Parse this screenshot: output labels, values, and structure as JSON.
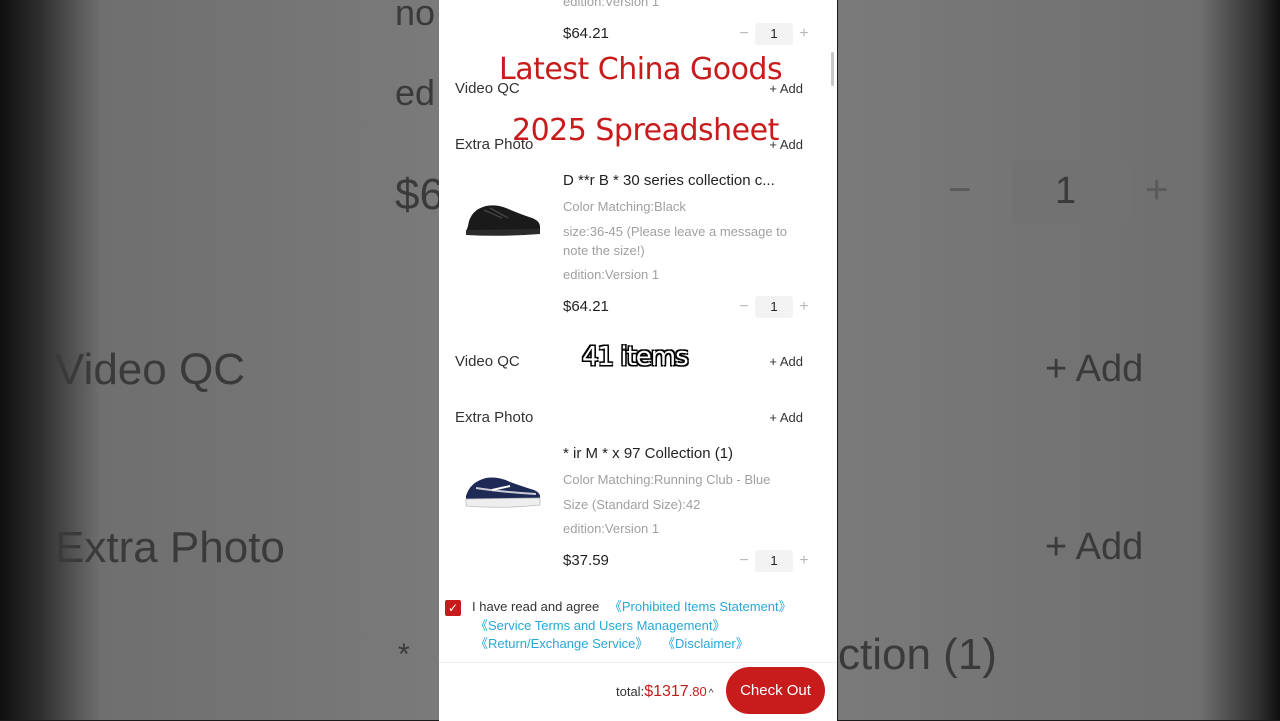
{
  "overlay": {
    "line1": "Latest China Goods",
    "line2": "2025 Spreadsheet",
    "items_count": "41 items"
  },
  "background_text": {
    "no": "no",
    "ed": "ed",
    "price": "$6",
    "qty_minus": "−",
    "qty_value": "1",
    "qty_plus": "+",
    "video_qc": "Video QC",
    "add1": "+ Add",
    "extra_photo": "Extra Photo",
    "add2": "+ Add",
    "star": "*",
    "collection": "ction (1)"
  },
  "cart": {
    "top_partial_spec": "edition:Version 1",
    "items": [
      {
        "price": "$64.21",
        "qty": "1"
      },
      {
        "title": "D **r B * 30 series collection c...",
        "spec1": "Color Matching:Black",
        "spec2": "size:36-45 (Please leave a message to note the size!)",
        "spec3": "edition:Version 1",
        "price": "$64.21",
        "qty": "1",
        "image": "black-sneaker"
      },
      {
        "title": "* ir M * x 97 Collection (1)",
        "spec1": "Color Matching:Running Club - Blue",
        "spec2": "Size (Standard Size):42",
        "spec3": "edition:Version 1",
        "price": "$37.59",
        "qty": "1",
        "image": "navy-sneaker"
      }
    ],
    "services": [
      {
        "label": "Video QC",
        "action": "+ Add"
      },
      {
        "label": "Extra Photo",
        "action": "+ Add"
      },
      {
        "label": "Video QC",
        "action": "+ Add"
      },
      {
        "label": "Extra Photo",
        "action": "+ Add"
      }
    ],
    "qty_minus": "−",
    "qty_plus": "+"
  },
  "agreement": {
    "checked": true,
    "prefix": "I have read and agree",
    "link1": "《Prohibited Items Statement》",
    "link2": "《Service Terms and Users Management》",
    "link3": "《Return/Exchange Service》",
    "link4": "《Disclaimer》"
  },
  "footer": {
    "total_label": "total:",
    "currency": "$",
    "total_int": "1317",
    "total_dec": ".80",
    "caret": "^",
    "checkout": "Check Out"
  },
  "colors": {
    "accent": "#c81c1c",
    "link": "#27a7d8"
  }
}
